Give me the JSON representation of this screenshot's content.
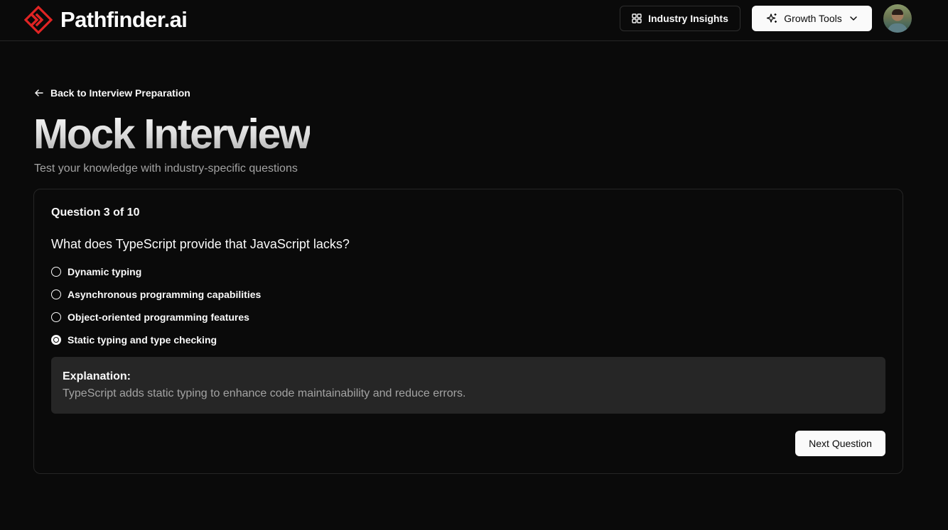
{
  "brand": {
    "name": "Pathfinder.ai",
    "icon": "logo-chevrons-icon",
    "accent": "#e02424"
  },
  "nav": {
    "industry_insights": {
      "label": "Industry Insights",
      "icon": "grid-icon"
    },
    "growth_tools": {
      "label": "Growth Tools",
      "icon": "sparkles-icon",
      "dropdown_icon": "chevron-down-icon"
    },
    "avatar": "user-avatar"
  },
  "page": {
    "back_link": "Back to Interview Preparation",
    "title": "Mock Interview",
    "subtitle": "Test your knowledge with industry-specific questions"
  },
  "quiz": {
    "counter": "Question 3 of 10",
    "question": "What does TypeScript provide that JavaScript lacks?",
    "options": [
      {
        "label": "Dynamic typing",
        "selected": false
      },
      {
        "label": "Asynchronous programming capabilities",
        "selected": false
      },
      {
        "label": "Object-oriented programming features",
        "selected": false
      },
      {
        "label": "Static typing and type checking",
        "selected": true
      }
    ],
    "explanation_title": "Explanation:",
    "explanation_text": "TypeScript adds static typing to enhance code maintainability and reduce errors.",
    "next_label": "Next Question"
  }
}
